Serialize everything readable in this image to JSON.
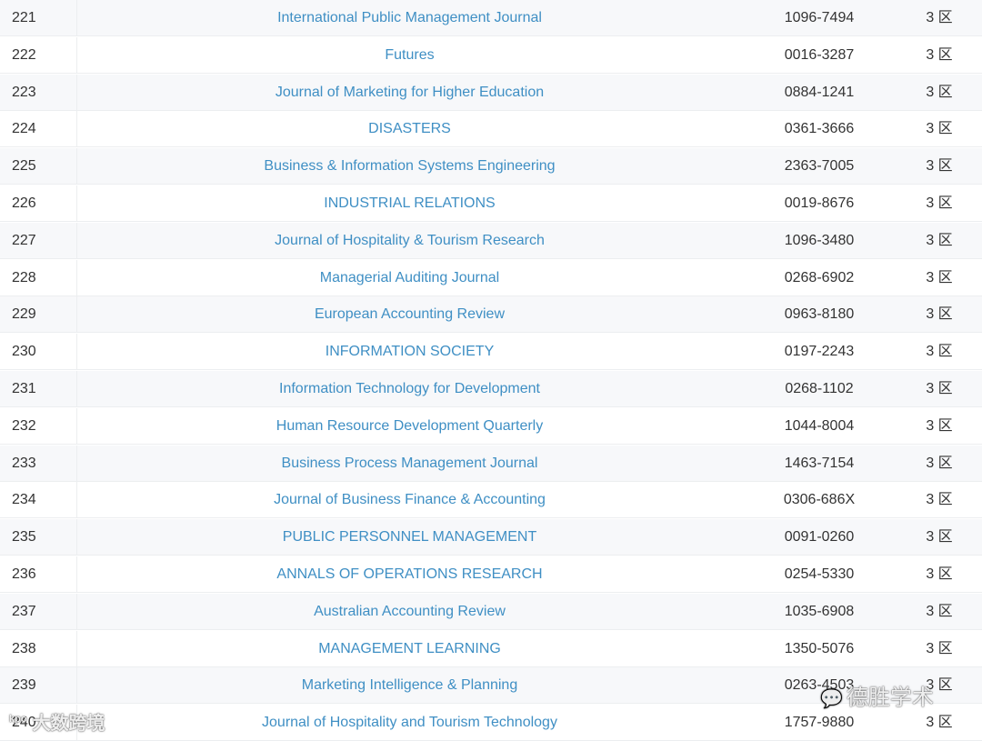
{
  "rows": [
    {
      "num": "221",
      "title": "International Public Management Journal",
      "issn": "1096-7494",
      "zone": "3 区"
    },
    {
      "num": "222",
      "title": "Futures",
      "issn": "0016-3287",
      "zone": "3 区"
    },
    {
      "num": "223",
      "title": "Journal of Marketing for Higher Education",
      "issn": "0884-1241",
      "zone": "3 区"
    },
    {
      "num": "224",
      "title": "DISASTERS",
      "issn": "0361-3666",
      "zone": "3 区"
    },
    {
      "num": "225",
      "title": "Business & Information Systems Engineering",
      "issn": "2363-7005",
      "zone": "3 区"
    },
    {
      "num": "226",
      "title": "INDUSTRIAL RELATIONS",
      "issn": "0019-8676",
      "zone": "3 区"
    },
    {
      "num": "227",
      "title": "Journal of Hospitality & Tourism Research",
      "issn": "1096-3480",
      "zone": "3 区"
    },
    {
      "num": "228",
      "title": "Managerial Auditing Journal",
      "issn": "0268-6902",
      "zone": "3 区"
    },
    {
      "num": "229",
      "title": "European Accounting Review",
      "issn": "0963-8180",
      "zone": "3 区"
    },
    {
      "num": "230",
      "title": "INFORMATION SOCIETY",
      "issn": "0197-2243",
      "zone": "3 区"
    },
    {
      "num": "231",
      "title": "Information Technology for Development",
      "issn": "0268-1102",
      "zone": "3 区"
    },
    {
      "num": "232",
      "title": "Human Resource Development Quarterly",
      "issn": "1044-8004",
      "zone": "3 区"
    },
    {
      "num": "233",
      "title": "Business Process Management Journal",
      "issn": "1463-7154",
      "zone": "3 区"
    },
    {
      "num": "234",
      "title": "Journal of Business Finance & Accounting",
      "issn": "0306-686X",
      "zone": "3 区"
    },
    {
      "num": "235",
      "title": "PUBLIC PERSONNEL MANAGEMENT",
      "issn": "0091-0260",
      "zone": "3 区"
    },
    {
      "num": "236",
      "title": "ANNALS OF OPERATIONS RESEARCH",
      "issn": "0254-5330",
      "zone": "3 区"
    },
    {
      "num": "237",
      "title": "Australian Accounting Review",
      "issn": "1035-6908",
      "zone": "3 区"
    },
    {
      "num": "238",
      "title": "MANAGEMENT LEARNING",
      "issn": "1350-5076",
      "zone": "3 区"
    },
    {
      "num": "239",
      "title": "Marketing Intelligence & Planning",
      "issn": "0263-4503",
      "zone": "3 区"
    },
    {
      "num": "240",
      "title": "Journal of Hospitality and Tourism Technology",
      "issn": "1757-9880",
      "zone": "3 区"
    }
  ],
  "watermark_left": {
    "tag": "kpo",
    "text": "大数跨境"
  },
  "watermark_right": {
    "icon": "wechat-icon",
    "text": "德胜学术"
  },
  "colors": {
    "link": "#3f8fc4",
    "text": "#333333",
    "stripe": "#f7f8fa"
  }
}
